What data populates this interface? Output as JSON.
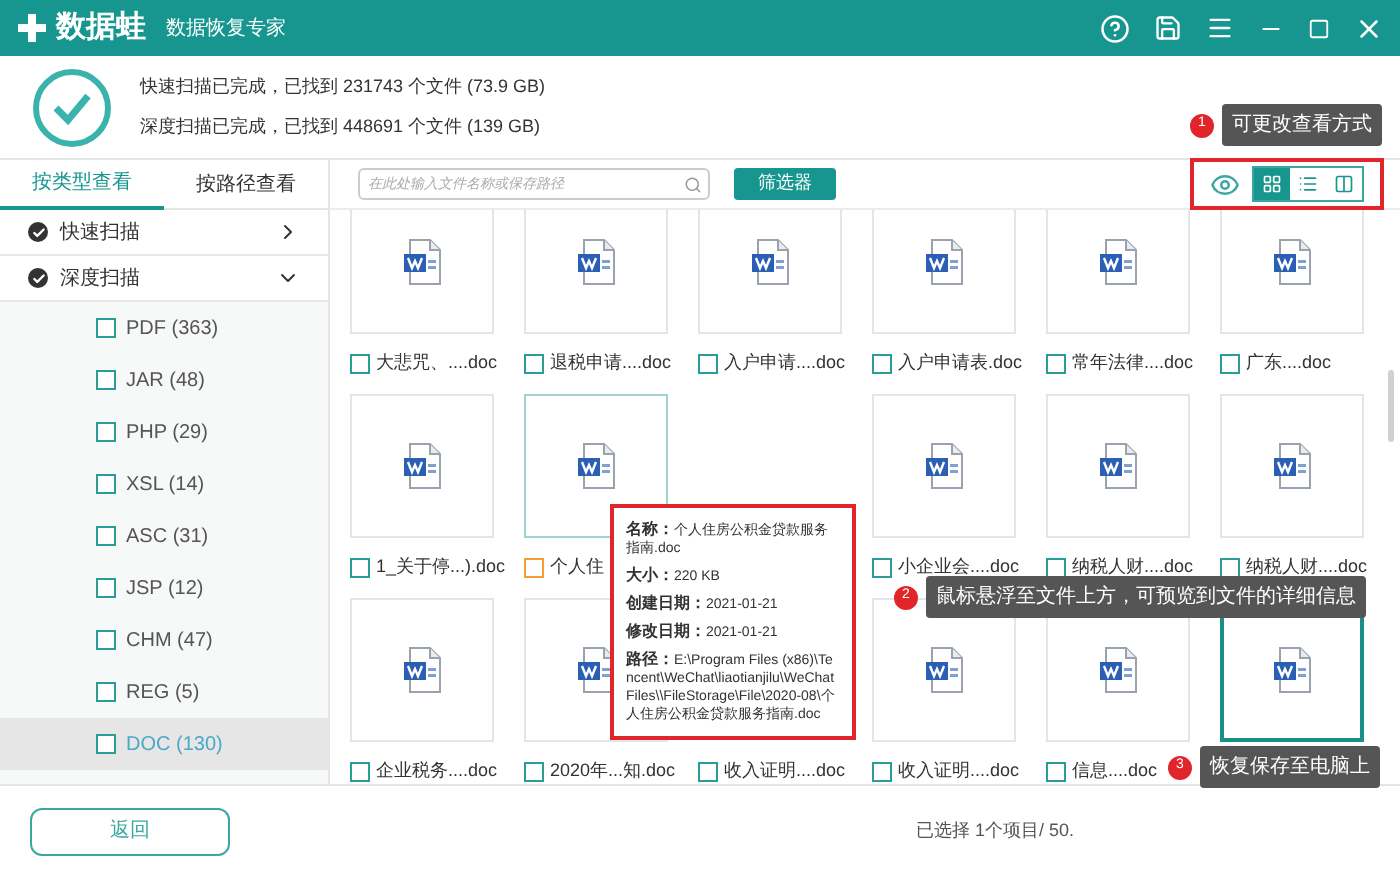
{
  "app": {
    "name": "数据蛙",
    "subtitle": "数据恢复专家"
  },
  "scan_summary": [
    "快速扫描已完成，已找到 231743 个文件 (73.9 GB)",
    "深度扫描已完成，已找到 448691 个文件 (139 GB)"
  ],
  "view_tabs": [
    {
      "label": "按类型查看",
      "selected": true
    },
    {
      "label": "按路径查看",
      "selected": false
    }
  ],
  "scan_groups": [
    {
      "label": "快速扫描",
      "checked": true,
      "expanded": false
    },
    {
      "label": "深度扫描",
      "checked": true,
      "expanded": true,
      "children": [
        {
          "label": "PDF (363)",
          "checked": false,
          "selected": false
        },
        {
          "label": "JAR (48)",
          "checked": false,
          "selected": false
        },
        {
          "label": "PHP (29)",
          "checked": false,
          "selected": false
        },
        {
          "label": "XSL (14)",
          "checked": false,
          "selected": false
        },
        {
          "label": "ASC (31)",
          "checked": false,
          "selected": false
        },
        {
          "label": "JSP (12)",
          "checked": false,
          "selected": false
        },
        {
          "label": "CHM (47)",
          "checked": false,
          "selected": false
        },
        {
          "label": "REG (5)",
          "checked": false,
          "selected": false
        },
        {
          "label": "DOC (130)",
          "checked": false,
          "selected": true
        }
      ]
    }
  ],
  "search": {
    "placeholder": "在此处输入文件名称或保存路径"
  },
  "filter_button": "筛选器",
  "view_modes": [
    {
      "kind": "thumbnails",
      "selected": true
    },
    {
      "kind": "list",
      "selected": false
    },
    {
      "kind": "preview",
      "selected": false
    }
  ],
  "files": [
    {
      "kind": "doc",
      "label": "大悲咒、....doc",
      "hovered": false,
      "selected": false
    },
    {
      "kind": "doc",
      "label": "退税申请....doc",
      "hovered": false,
      "selected": false
    },
    {
      "kind": "doc",
      "label": "入户申请....doc",
      "hovered": false,
      "selected": false
    },
    {
      "kind": "doc",
      "label": "入户申请表.doc",
      "hovered": false,
      "selected": false
    },
    {
      "kind": "doc",
      "label": "常年法律....doc",
      "hovered": false,
      "selected": false
    },
    {
      "kind": "doc",
      "label": "广东....doc",
      "hovered": false,
      "selected": false
    },
    {
      "kind": "doc",
      "label": "1_关于停...).doc",
      "hovered": false,
      "selected": false
    },
    {
      "kind": "doc",
      "label": "个人住",
      "hovered": true,
      "selected": false
    },
    {
      "kind": "covered"
    },
    {
      "kind": "doc",
      "label": "小企业会....doc",
      "hovered": false,
      "selected": false
    },
    {
      "kind": "doc",
      "label": "纳税人财....doc",
      "hovered": false,
      "selected": false
    },
    {
      "kind": "doc",
      "label": "纳税人财....doc",
      "hovered": false,
      "selected": false
    },
    {
      "kind": "doc",
      "label": "企业税务....doc",
      "hovered": false,
      "selected": false
    },
    {
      "kind": "doc",
      "label": "2020年...知.doc",
      "hovered": false,
      "selected": false
    },
    {
      "kind": "covered",
      "label": "收入证明....doc",
      "hovered": false
    },
    {
      "kind": "doc",
      "label": "收入证明....doc",
      "hovered": false,
      "selected": false
    },
    {
      "kind": "doc",
      "label": "信息....doc",
      "hovered": false,
      "selected": false
    },
    {
      "kind": "doc",
      "selected": true
    }
  ],
  "preview": {
    "fields": [
      {
        "label": "名称：",
        "value": "个人住房公积金贷款服务指南.doc"
      },
      {
        "label": "大小：",
        "value": "220 KB"
      },
      {
        "label": "创建日期：",
        "value": "2021-01-21"
      },
      {
        "label": "修改日期：",
        "value": "2021-01-21"
      },
      {
        "label": "路径：",
        "value": "E:\\Program Files (x86)\\Tencent\\WeChat\\liaotianjilu\\WeChat Files\\\\FileStorage\\File\\2020-08\\个人住房公积金贷款服务指南.doc"
      }
    ]
  },
  "annotations": [
    {
      "number": "1",
      "text": "可更改查看方式"
    },
    {
      "number": "2",
      "text": "鼠标悬浮至文件上方，可预览到文件的详细信息"
    },
    {
      "number": "3",
      "text": "恢复保存至电脑上"
    }
  ],
  "back_button": "返回",
  "status": "已选择 1个项目/ 50."
}
